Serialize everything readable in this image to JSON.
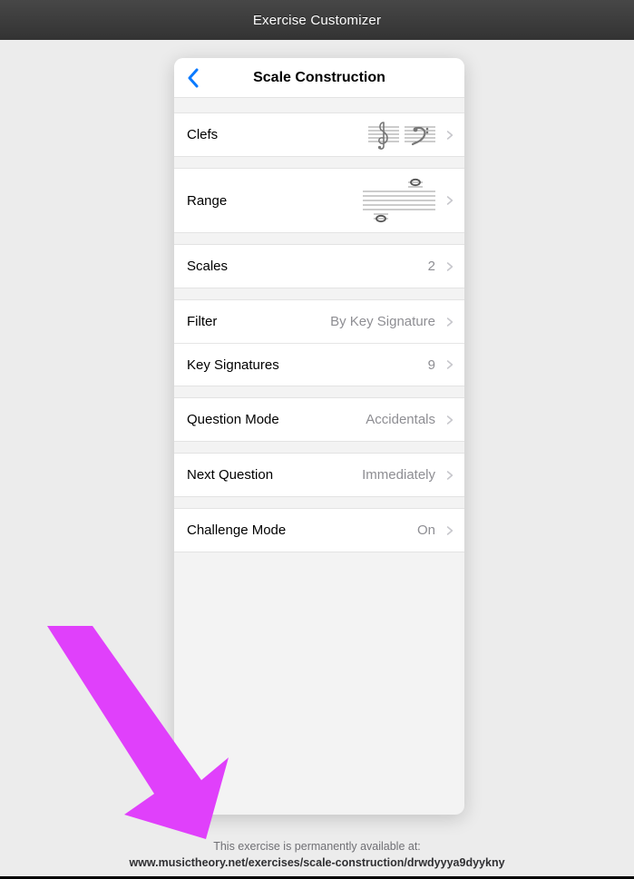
{
  "titlebar": {
    "title": "Exercise Customizer"
  },
  "panel": {
    "title": "Scale Construction",
    "rows": {
      "clefs": {
        "label": "Clefs"
      },
      "range": {
        "label": "Range"
      },
      "scales": {
        "label": "Scales",
        "value": "2"
      },
      "filter": {
        "label": "Filter",
        "value": "By Key Signature"
      },
      "keysigs": {
        "label": "Key Signatures",
        "value": "9"
      },
      "question_mode": {
        "label": "Question Mode",
        "value": "Accidentals"
      },
      "next_question": {
        "label": "Next Question",
        "value": "Immediately"
      },
      "challenge_mode": {
        "label": "Challenge Mode",
        "value": "On"
      }
    }
  },
  "footer": {
    "text": "This exercise is permanently available at:",
    "url": "www.musictheory.net/exercises/scale-construction/drwdyyya9dyykny"
  },
  "icons": {
    "back": "back-chevron-icon",
    "row_chevron": "disclosure-chevron-icon",
    "treble": "treble-clef-icon",
    "bass": "bass-clef-icon",
    "range_staff": "range-staff-icon"
  },
  "annotation": {
    "color": "#E040FB"
  }
}
